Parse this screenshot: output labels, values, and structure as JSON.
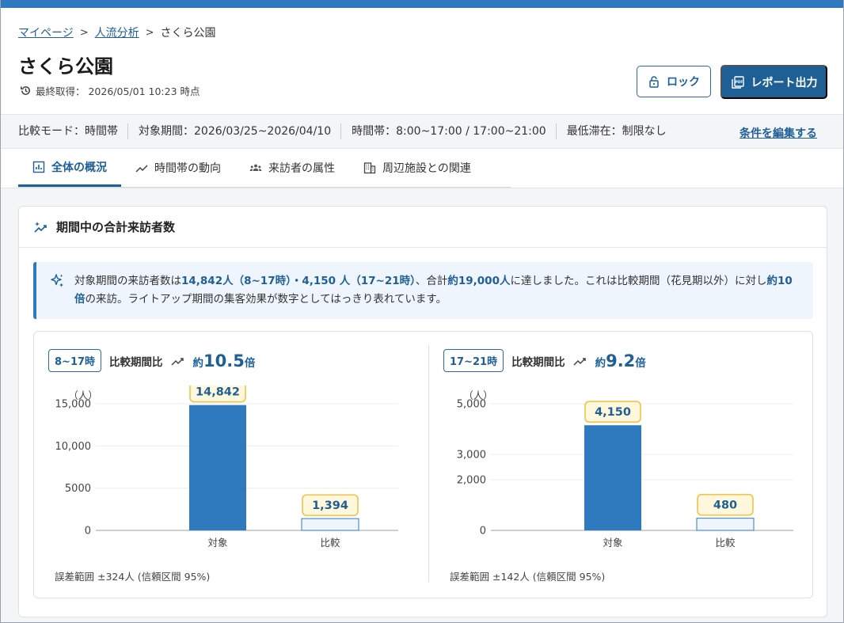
{
  "breadcrumb": {
    "items": [
      "マイページ",
      "人流分析"
    ],
    "current": "さくら公園"
  },
  "page": {
    "title": "さくら公園",
    "last_fetch": "最終取得： 2026/05/01 10:23 時点"
  },
  "actions": {
    "lock_label": "ロック",
    "report_label": "レポート出力"
  },
  "conditions": {
    "items": [
      "比較モード：時間帯",
      "対象期間：2026/03/25~2026/04/10",
      "時間帯：8:00~17:00 / 17:00~21:00",
      "最低滞在：制限なし"
    ],
    "edit_label": "条件を編集する"
  },
  "tabs": [
    {
      "label": "全体の概況",
      "icon": "chart-box-icon",
      "active": true
    },
    {
      "label": "時間帯の動向",
      "icon": "trend-icon",
      "active": false
    },
    {
      "label": "来訪者の属性",
      "icon": "people-icon",
      "active": false
    },
    {
      "label": "周辺施設との関連",
      "icon": "building-icon",
      "active": false
    }
  ],
  "card": {
    "title": "期間中の合計来訪者数"
  },
  "summary": {
    "p1": "対象期間の来訪者数は",
    "h1": "14,842人（8~17時）・4,150 人（17~21時）",
    "p2": "、合計",
    "h2": "約19,000人",
    "p3": "に達しました。これは比較期間（花見期以外）に対し",
    "h3": "約10倍",
    "p4": "の来訪。ライトアップ期間の集客効果が数字としてはっきり表れています。"
  },
  "colors": {
    "accent": "#1e5f96",
    "bar_target": "#2f7abf",
    "bar_compare": "#eef5fc",
    "label_border": "#f2c14e",
    "label_bg": "#fff8dc"
  },
  "chart_data": [
    {
      "type": "bar",
      "badge": "8~17時",
      "ratio_prefix": "比較期間比",
      "ratio_approx": "約",
      "ratio_value": "10.5",
      "ratio_unit": "倍",
      "unit_label": "（人）",
      "categories": [
        "対象",
        "比較"
      ],
      "values": [
        14842,
        1394
      ],
      "value_labels": [
        "14,842",
        "1,394"
      ],
      "yticks": [
        0,
        5000,
        10000,
        15000
      ],
      "ytick_labels": [
        "0",
        "5000",
        "10,000",
        "15,000"
      ],
      "ylim": [
        0,
        15000
      ],
      "note": "誤差範囲 ±324人 (信頼区間 95%)"
    },
    {
      "type": "bar",
      "badge": "17~21時",
      "ratio_prefix": "比較期間比",
      "ratio_approx": "約",
      "ratio_value": "9.2",
      "ratio_unit": "倍",
      "unit_label": "（人）",
      "categories": [
        "対象",
        "比較"
      ],
      "values": [
        4150,
        480
      ],
      "value_labels": [
        "4,150",
        "480"
      ],
      "yticks": [
        0,
        2000,
        3000,
        5000
      ],
      "ytick_labels": [
        "0",
        "2,000",
        "3,000",
        "5,000"
      ],
      "ylim": [
        0,
        5000
      ],
      "note": "誤差範囲 ±142人 (信頼区間 95%)"
    }
  ]
}
